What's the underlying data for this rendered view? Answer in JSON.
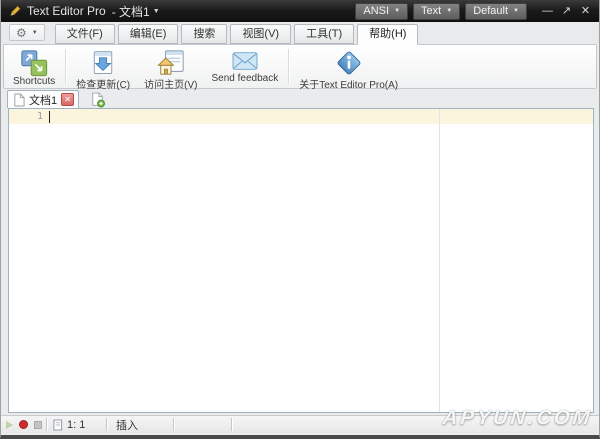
{
  "titlebar": {
    "app_title": "Text Editor Pro",
    "doc_title": "- 文档1",
    "encoding_dropdown": "ANSI",
    "filetype_dropdown": "Text",
    "highlighter_dropdown": "Default"
  },
  "glyphs": {
    "caret_down": "▼",
    "gear": "⚙",
    "minimize": "—",
    "maximize": "↗",
    "close": "✕",
    "close_small": "✕"
  },
  "menubar": {
    "tabs": [
      "文件(F)",
      "编辑(E)",
      "搜索",
      "视图(V)",
      "工具(T)",
      "帮助(H)"
    ],
    "active_tab": "帮助(H)"
  },
  "ribbon": {
    "buttons": [
      {
        "label": "Shortcuts",
        "icon": "shortcuts-icon"
      },
      {
        "label": "检查更新(C)",
        "icon": "check-updates-icon"
      },
      {
        "label": "访问主页(V)",
        "icon": "visit-homepage-icon"
      },
      {
        "label": "Send feedback",
        "icon": "send-feedback-icon"
      },
      {
        "label": "关于Text Editor Pro(A)",
        "icon": "about-info-icon"
      }
    ]
  },
  "document_tabs": {
    "active_label": "文档1"
  },
  "editor": {
    "line_number": "1"
  },
  "statusbar": {
    "position": "1: 1",
    "mode": "插入"
  },
  "watermark": {
    "text": "APYUN.COM"
  },
  "colors": {
    "titlebar_bg": "#1c1c1c",
    "ribbon_border": "#c3c9ce",
    "active_line": "#fbf5de",
    "editor_border": "#9db4c0",
    "close_red": "#d96767",
    "new_doc_green": "#6db33f",
    "record_red": "#cf2b2b",
    "about_blue": "#5b9bd5"
  }
}
